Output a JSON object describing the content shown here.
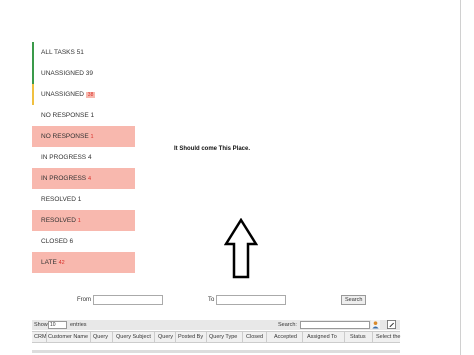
{
  "sidebar": {
    "items": [
      {
        "label": "ALL TASKS",
        "count": "51"
      },
      {
        "label": "UNASSIGNED",
        "count": "39"
      },
      {
        "label": "UNASSIGNED",
        "count": "38"
      },
      {
        "label": "NO RESPONSE",
        "count": "1"
      },
      {
        "label": "NO RESPONSE",
        "count": "1"
      },
      {
        "label": "IN PROGRESS",
        "count": "4"
      },
      {
        "label": "IN PROGRESS",
        "count": "4"
      },
      {
        "label": "RESOLVED",
        "count": "1"
      },
      {
        "label": "RESOLVED",
        "count": "1"
      },
      {
        "label": "CLOSED",
        "count": "6"
      },
      {
        "label": "LATE",
        "count": "42"
      }
    ]
  },
  "main": {
    "note": "It Should come This Place."
  },
  "filters": {
    "from_label": "From",
    "to_label": "To",
    "search_button": "Search"
  },
  "table": {
    "show_label": "Show",
    "entries_value": "10",
    "entries_label": "entries",
    "search_label": "Search:",
    "columns": [
      "CRM",
      "Customer Name",
      "Query",
      "Query Subject",
      "Query",
      "Posted By",
      "Query Type",
      "Closed",
      "Accepted",
      "Assigned To",
      "Status",
      "Select the"
    ]
  },
  "colors": {
    "highlight": "#f8b8ae",
    "bar_green": "#3a9a4a",
    "bar_yellow": "#f0c040",
    "count_red": "#d9302a"
  }
}
